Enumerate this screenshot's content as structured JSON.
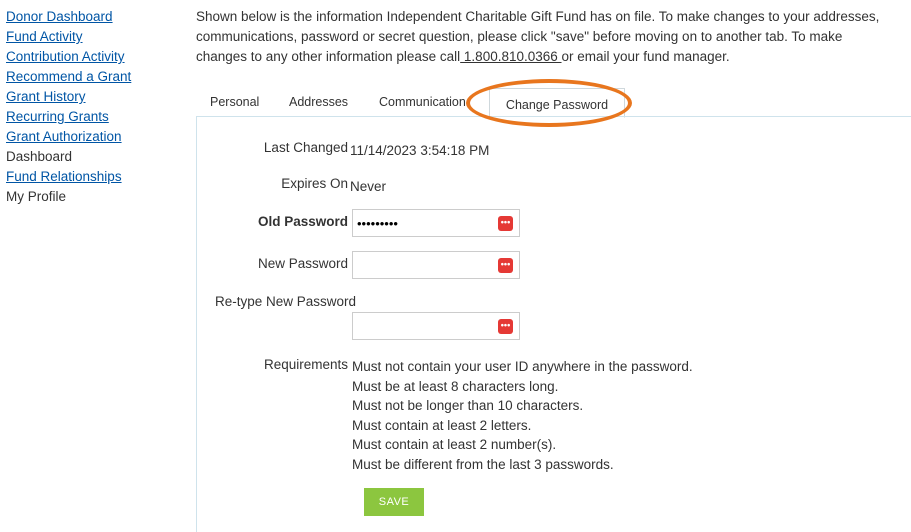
{
  "sidebar": {
    "items": [
      {
        "label": "Donor Dashboard"
      },
      {
        "label": "Fund Activity"
      },
      {
        "label": "Contribution Activity"
      },
      {
        "label": "Recommend a Grant"
      },
      {
        "label": "Grant History"
      },
      {
        "label": "Recurring Grants"
      },
      {
        "label": "Grant Authorization"
      },
      {
        "label": "Dashboard"
      },
      {
        "label": "Fund Relationships"
      },
      {
        "label": "My Profile"
      }
    ]
  },
  "intro": {
    "line1": "Shown below is the information Independent Charitable Gift Fund has on file. To make changes to your addresses,",
    "line2": "communications, password or secret question, please click \"save\" before moving on to another tab. To make",
    "line3_pre": "changes to any other information please call",
    "phone": " 1.800.810.0366 ",
    "line3_post": "or email your fund manager."
  },
  "tabs": {
    "personal": "Personal",
    "addresses": "Addresses",
    "communications": "Communication",
    "change_password": "Change Password"
  },
  "form": {
    "last_changed_label": "Last Changed",
    "last_changed_value": "11/14/2023 3:54:18 PM",
    "expires_label": "Expires On",
    "expires_value": "Never",
    "old_password_label": "Old Password",
    "old_password_value": "•••••••••",
    "new_password_label": "New Password",
    "new_password_value": "",
    "retype_label": "Re-type New Password",
    "retype_value": "",
    "requirements_label": "Requirements",
    "requirements": [
      "Must not contain your user ID anywhere in the password.",
      "Must be at least 8 characters long.",
      "Must not be longer than 10 characters.",
      "Must contain at least 2 letters.",
      "Must contain at least 2 number(s).",
      "Must be different from the last 3 passwords."
    ],
    "save_label": "SAVE"
  },
  "colors": {
    "link": "#0055a5",
    "save_button": "#8cc63f",
    "highlight": "#e8761e",
    "password_icon": "#e53935"
  },
  "icons": {
    "password_manager": "password-manager-icon"
  }
}
